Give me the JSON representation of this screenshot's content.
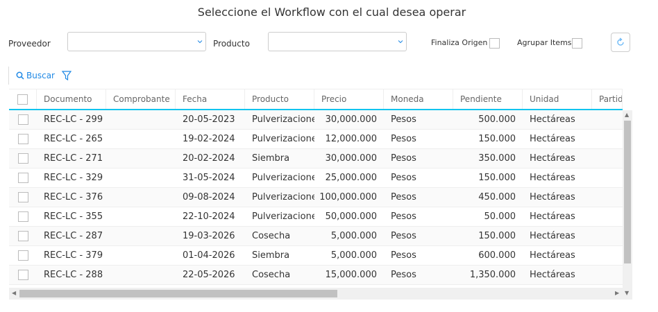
{
  "title": "Seleccione el Workflow con el cual desea operar",
  "filters": {
    "proveedor_label": "Proveedor",
    "proveedor_value": "",
    "producto_label": "Producto",
    "producto_value": "",
    "finaliza_origen_label": "Finaliza Origen",
    "agrupar_items_label": "Agrupar Items"
  },
  "toolbar": {
    "search_label": "Buscar"
  },
  "columns": [
    "Documento",
    "Comprobante",
    "Fecha",
    "Producto",
    "Precio",
    "Moneda",
    "Pendiente",
    "Unidad",
    "Partida"
  ],
  "rows": [
    [
      "REC-LC - 299",
      "",
      "20-05-2023",
      "Pulverizaciones",
      "30,000.000",
      "Pesos",
      "500.000",
      "Hectáreas",
      ""
    ],
    [
      "REC-LC - 265",
      "",
      "19-02-2024",
      "Pulverizaciones",
      "12,000.000",
      "Pesos",
      "150.000",
      "Hectáreas",
      ""
    ],
    [
      "REC-LC - 271",
      "",
      "20-02-2024",
      "Siembra",
      "30,000.000",
      "Pesos",
      "350.000",
      "Hectáreas",
      ""
    ],
    [
      "REC-LC - 329",
      "",
      "31-05-2024",
      "Pulverizaciones",
      "25,000.000",
      "Pesos",
      "150.000",
      "Hectáreas",
      ""
    ],
    [
      "REC-LC - 376",
      "",
      "09-08-2024",
      "Pulverizaciones",
      "100,000.000",
      "Pesos",
      "450.000",
      "Hectáreas",
      ""
    ],
    [
      "REC-LC - 355",
      "",
      "22-10-2024",
      "Pulverizaciones",
      "50,000.000",
      "Pesos",
      "50.000",
      "Hectáreas",
      ""
    ],
    [
      "REC-LC - 287",
      "",
      "19-03-2026",
      "Cosecha",
      "5,000.000",
      "Pesos",
      "150.000",
      "Hectáreas",
      ""
    ],
    [
      "REC-LC - 379",
      "",
      "01-04-2026",
      "Siembra",
      "5,000.000",
      "Pesos",
      "600.000",
      "Hectáreas",
      ""
    ],
    [
      "REC-LC - 288",
      "",
      "22-05-2026",
      "Cosecha",
      "15,000.000",
      "Pesos",
      "1,350.000",
      "Hectáreas",
      ""
    ]
  ]
}
